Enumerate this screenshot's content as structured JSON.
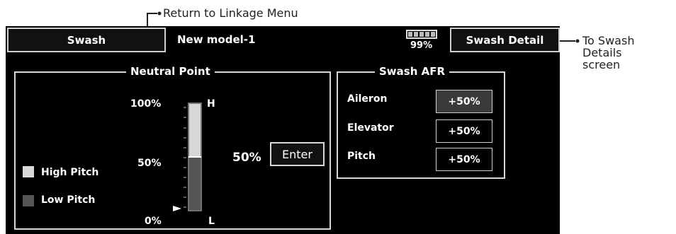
{
  "callouts": {
    "return_linkage": "Return to Linkage Menu",
    "to_swash_details": [
      "To Swash",
      "Details",
      "screen"
    ]
  },
  "header": {
    "swash_button": "Swash",
    "model_name": "New model-1",
    "battery_percent": "99%",
    "swash_detail_button": "Swash Detail"
  },
  "neutral_point": {
    "title": "Neutral Point",
    "scale_top": "100%",
    "scale_mid": "50%",
    "scale_bottom": "0%",
    "high_marker": "H",
    "low_marker": "L",
    "value": "50%",
    "level_fraction": 0.5,
    "enter_button": "Enter",
    "legend_high": "High Pitch",
    "legend_low": "Low Pitch"
  },
  "swash_afr": {
    "title": "Swash AFR",
    "rows": [
      {
        "label": "Aileron",
        "value": "+50%"
      },
      {
        "label": "Elevator",
        "value": "+50%"
      },
      {
        "label": "Pitch",
        "value": "+50%"
      }
    ]
  },
  "colors": {
    "screen_bg": "#000000",
    "high_pitch": "#d7d7d7",
    "low_pitch": "#555555",
    "value_bg_selected": "#3a3a3a"
  }
}
